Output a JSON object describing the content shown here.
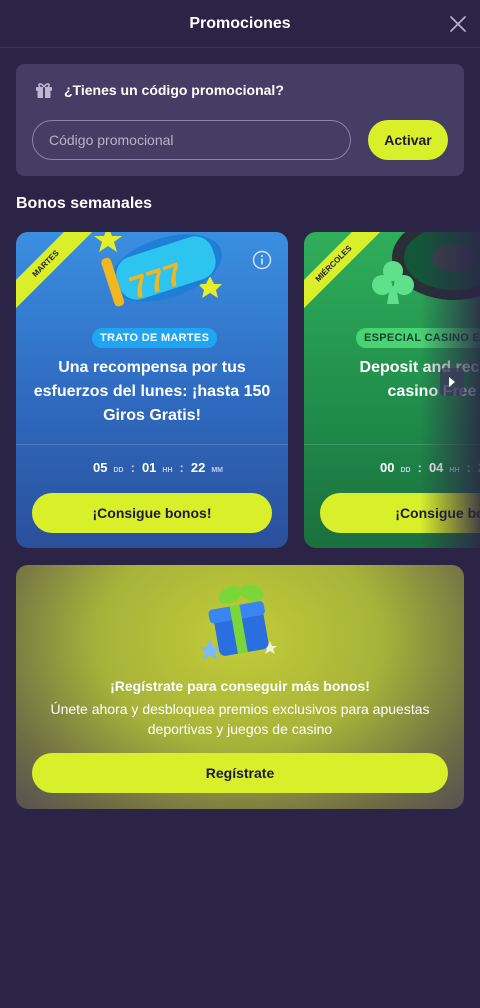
{
  "header": {
    "title": "Promociones",
    "close_icon": "close-icon"
  },
  "promo": {
    "question": "¿Tienes un código promocional?",
    "icon": "gift-icon",
    "input_placeholder": "Código promocional",
    "input_value": "",
    "button_label": "Activar"
  },
  "weekly": {
    "title": "Bonos semanales",
    "cards": [
      {
        "ribbon": "MARTES",
        "tag": "TRATO DE MARTES",
        "text": "Una recompensa por tus esfuerzos del lunes: ¡hasta 150 Giros Gratis!",
        "countdown": {
          "dd": "05",
          "hh": "01",
          "mm": "22",
          "dd_label": "DD",
          "hh_label": "HH",
          "mm_label": "MM"
        },
        "button_label": "¡Consigue bonos!"
      },
      {
        "ribbon": "MIÉRCOLES",
        "tag": "ESPECIAL CASINO E",
        "text_line1": "Deposit and rece",
        "text_line2": "casino Free",
        "countdown": {
          "dd": "00",
          "hh": "04",
          "mm": "2",
          "dd_label": "DD",
          "hh_label": "HH"
        },
        "button_label": "¡Consigue bo"
      }
    ]
  },
  "register": {
    "title": "¡Regístrate para conseguir más bonos!",
    "text": "Únete ahora y desbloquea premios exclusivos para apuestas deportivas y juegos de casino",
    "button_label": "Regístrate"
  },
  "colors": {
    "background": "#2b24d7",
    "accent": "#d9ef2a",
    "card_blue": "#3a8fe0",
    "card_green": "#2fae5a"
  }
}
